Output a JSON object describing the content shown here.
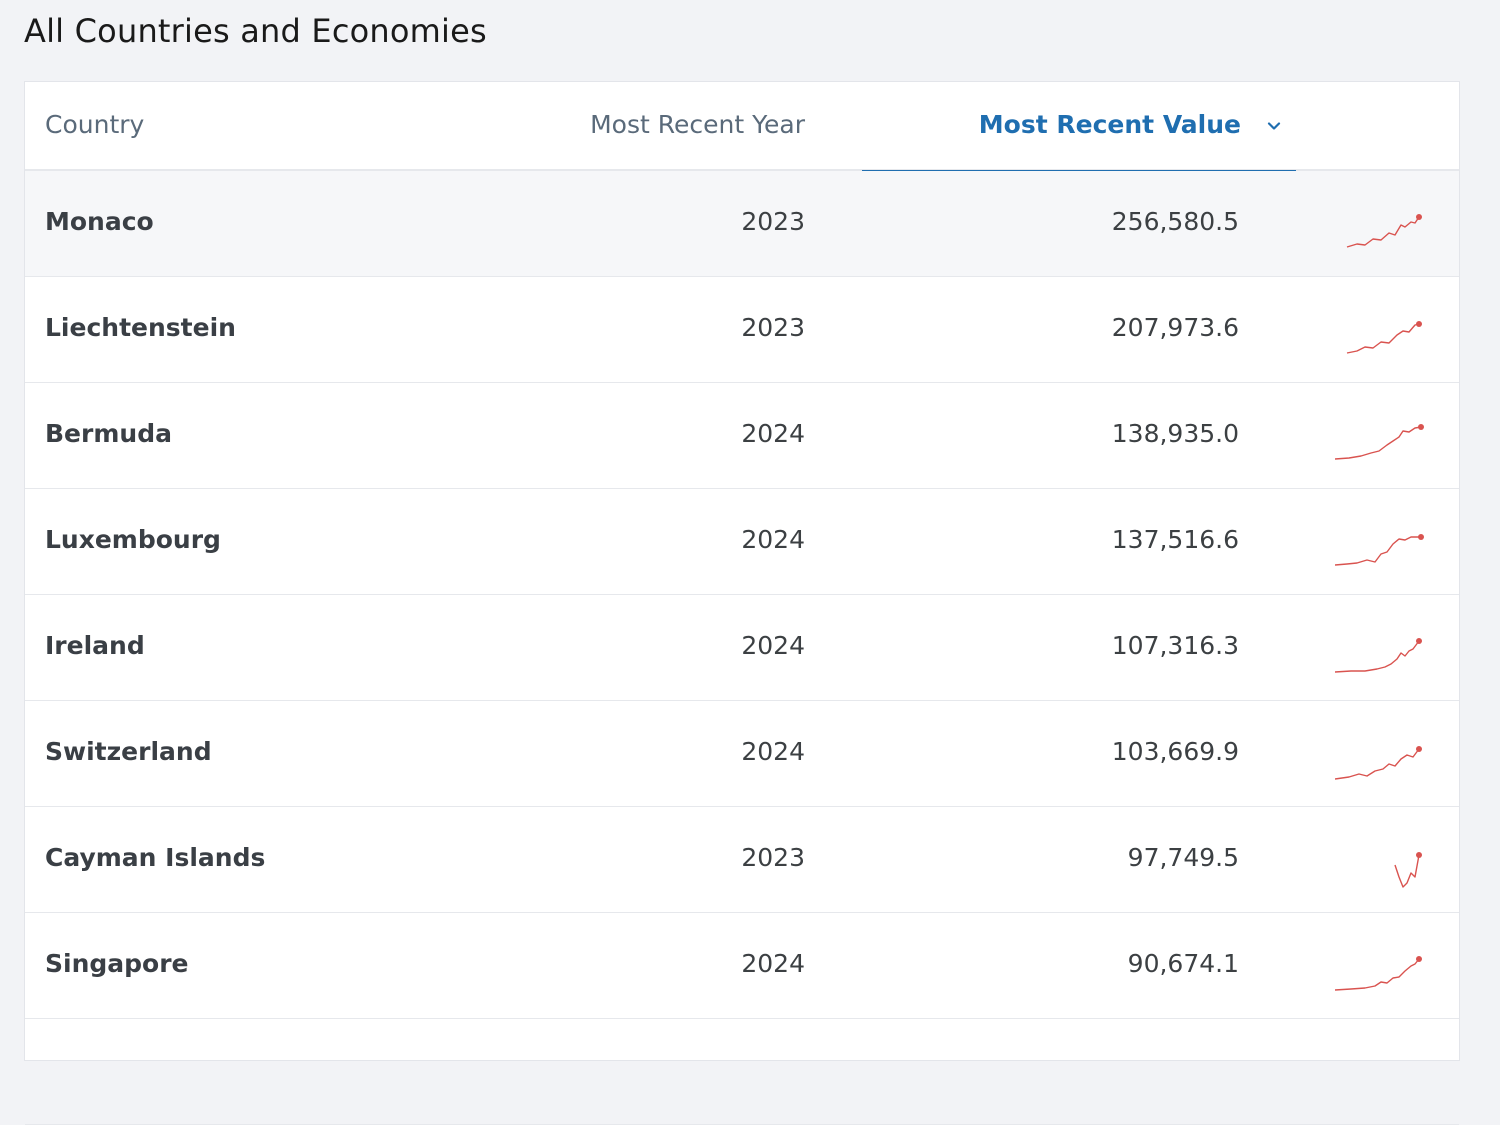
{
  "page": {
    "title": "All Countries and Economies"
  },
  "table": {
    "headers": {
      "country": "Country",
      "year": "Most Recent Year",
      "value": "Most Recent Value"
    },
    "sort_icon": "chevron-down-icon",
    "sparkline_color": "#d9534f",
    "accent_color": "#1f6eb0",
    "rows": [
      {
        "country": "Monaco",
        "year": "2023",
        "value": "256,580.5"
      },
      {
        "country": "Liechtenstein",
        "year": "2023",
        "value": "207,973.6"
      },
      {
        "country": "Bermuda",
        "year": "2024",
        "value": "138,935.0"
      },
      {
        "country": "Luxembourg",
        "year": "2024",
        "value": "137,516.6"
      },
      {
        "country": "Ireland",
        "year": "2024",
        "value": "107,316.3"
      },
      {
        "country": "Switzerland",
        "year": "2024",
        "value": "103,669.9"
      },
      {
        "country": "Cayman Islands",
        "year": "2023",
        "value": "97,749.5"
      },
      {
        "country": "Singapore",
        "year": "2024",
        "value": "90,674.1"
      },
      {
        "country": "",
        "year": "",
        "value": ""
      }
    ]
  }
}
